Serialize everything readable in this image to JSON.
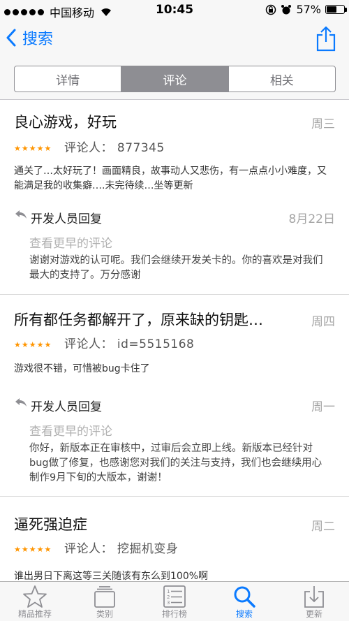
{
  "status_bar": {
    "carrier": "中国移动",
    "time": "10:45",
    "battery_percent": "57%",
    "battery_level": 0.57
  },
  "nav": {
    "back_label": "搜索"
  },
  "segments": [
    {
      "label": "详情",
      "active": false
    },
    {
      "label": "评论",
      "active": true
    },
    {
      "label": "相关",
      "active": false
    }
  ],
  "reviews": [
    {
      "title": "良心游戏，好玩",
      "date": "周三",
      "stars": 5,
      "reviewer": "评论人： 877345",
      "body": "通关了…太好玩了！画面精良，故事动人又悲伤，有一点点小小难度，又能满足我的收集癖….未完待续…坐等更新",
      "dev_label": "开发人员回复",
      "dev_date": "8月22日",
      "earlier": "查看更早的评论",
      "dev_body": "谢谢对游戏的认可呢。我们会继续开发关卡的。你的喜欢是对我们最大的支持了。万分感谢"
    },
    {
      "title": "所有都任务都解开了，原来缺的钥匙…",
      "date": "周四",
      "stars": 5,
      "reviewer": "评论人： id=5515168",
      "body": "游戏很不错，可惜被bug卡住了",
      "dev_label": "开发人员回复",
      "dev_date": "周一",
      "earlier": "查看更早的评论",
      "dev_body": "你好，新版本正在审核中，过审后会立即上线。新版本已经针对bug做了修复，也感谢您对我们的关注与支持，我们也会继续用心制作9月下旬的大版本，谢谢！"
    },
    {
      "title": "逼死强迫症",
      "date": "周二",
      "stars": 5,
      "reviewer": "评论人： 挖掘机变身",
      "body": "谁出男日下离这等三关随该有东么到100%啊"
    }
  ],
  "tabs": [
    {
      "label": "精品推荐",
      "icon": "star-icon",
      "active": false
    },
    {
      "label": "类别",
      "icon": "categories-icon",
      "active": false
    },
    {
      "label": "排行榜",
      "icon": "charts-icon",
      "active": false
    },
    {
      "label": "搜索",
      "icon": "search-icon",
      "active": true
    },
    {
      "label": "更新",
      "icon": "updates-icon",
      "active": false
    }
  ],
  "colors": {
    "accent": "#0a7aff",
    "star": "#ff9500",
    "muted": "#a5a5a5"
  }
}
